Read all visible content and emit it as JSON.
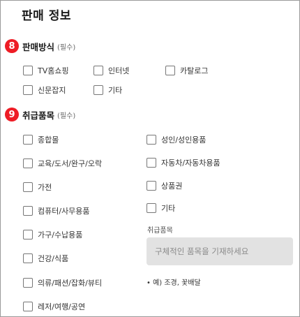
{
  "page_title": "판매 정보",
  "section1": {
    "number": "8",
    "title": "판매방식",
    "required": "(필수)",
    "options": [
      "TV홈쇼핑",
      "인터넷",
      "카탈로그",
      "신문잡지",
      "기타"
    ]
  },
  "section2": {
    "number": "9",
    "title": "취급품목",
    "required": "(필수)",
    "left_options": [
      "종합몰",
      "교육/도서/완구/오락",
      "가전",
      "컴퓨터/사무용품",
      "가구/수납용품",
      "건강/식품",
      "의류/패션/잡화/뷰티",
      "레저/여행/공연"
    ],
    "right_options": [
      "성인/성인용품",
      "자동차/자동차용품",
      "상품권",
      "기타"
    ],
    "field_label": "취급품목",
    "input_placeholder": "구체적인 품목을 기재하세요",
    "input_value": "",
    "hint": "• 예) 조경, 꽃배달"
  },
  "colors": {
    "badge": "#ee1c25",
    "input_bg": "#e2e2e2"
  }
}
